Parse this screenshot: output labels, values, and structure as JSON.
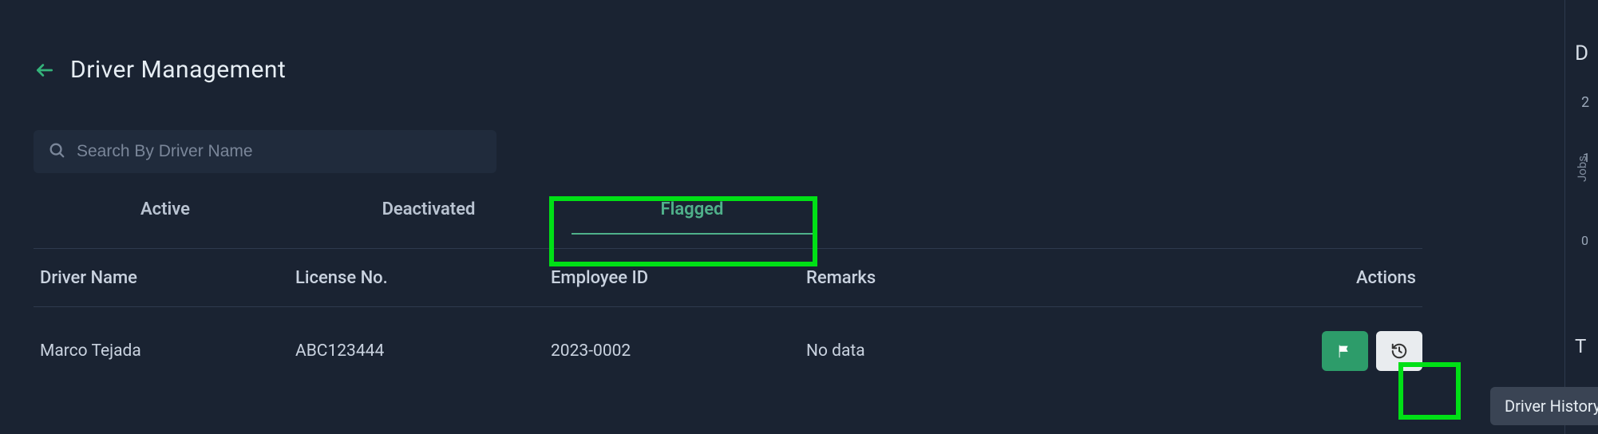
{
  "header": {
    "title": "Driver Management"
  },
  "search": {
    "placeholder": "Search By Driver Name",
    "value": ""
  },
  "tabs": [
    {
      "label": "Active",
      "active": false
    },
    {
      "label": "Deactivated",
      "active": false
    },
    {
      "label": "Flagged",
      "active": true
    }
  ],
  "table": {
    "columns": {
      "driver_name": "Driver Name",
      "license_no": "License No.",
      "employee_id": "Employee ID",
      "remarks": "Remarks",
      "actions": "Actions"
    },
    "rows": [
      {
        "driver_name": "Marco Tejada",
        "license_no": "ABC123444",
        "employee_id": "2023-0002",
        "remarks": "No data"
      }
    ]
  },
  "tooltip": {
    "history": "Driver History"
  },
  "right_panel": {
    "letter1": "D",
    "num_top": "2",
    "jobs_label": "Jobs",
    "num_mid": "1",
    "zero": "0",
    "letter2": "T"
  },
  "icons": {
    "back": "arrow-left-icon",
    "search": "search-icon",
    "flag": "flag-icon",
    "history": "history-icon"
  }
}
